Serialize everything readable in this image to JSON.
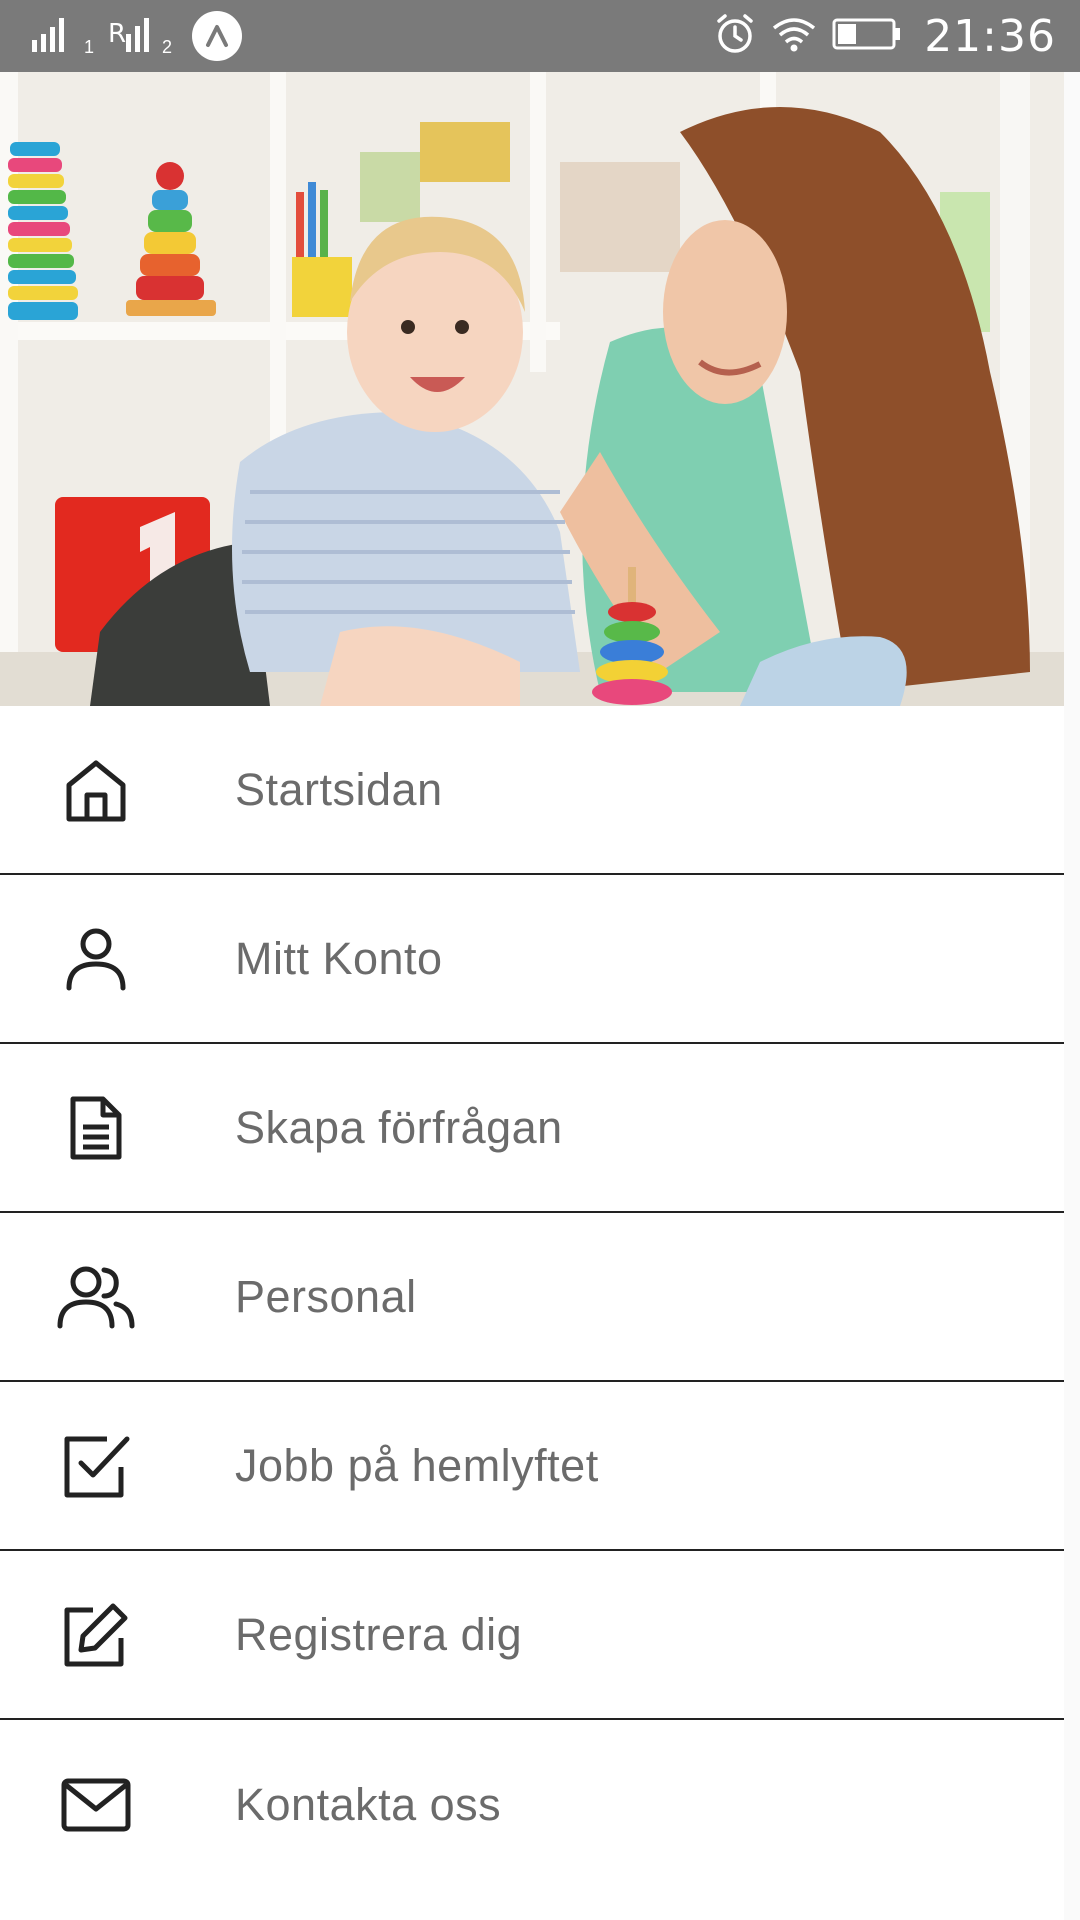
{
  "status_bar": {
    "time": "21:36",
    "sim2_label": "2",
    "sim1_label": "1",
    "icons": [
      "signal-sim1-icon",
      "signal-sim2-icon",
      "app-notification-icon",
      "alarm-icon",
      "wifi-icon",
      "battery-icon"
    ],
    "background_color": "#7a7a7a"
  },
  "hero": {
    "image": "photo-mother-and-baby-playing-with-toys"
  },
  "menu": {
    "items": [
      {
        "label": "Startsidan",
        "icon": "home-icon"
      },
      {
        "label": "Mitt Konto",
        "icon": "user-icon"
      },
      {
        "label": "Skapa förfrågan",
        "icon": "document-icon"
      },
      {
        "label": "Personal",
        "icon": "users-icon"
      },
      {
        "label": "Jobb på hemlyftet",
        "icon": "checkbox-icon"
      },
      {
        "label": "Registrera dig",
        "icon": "edit-icon"
      },
      {
        "label": "Kontakta oss",
        "icon": "mail-icon"
      }
    ],
    "text_color": "#6b6b6b",
    "divider_color": "#222222"
  }
}
